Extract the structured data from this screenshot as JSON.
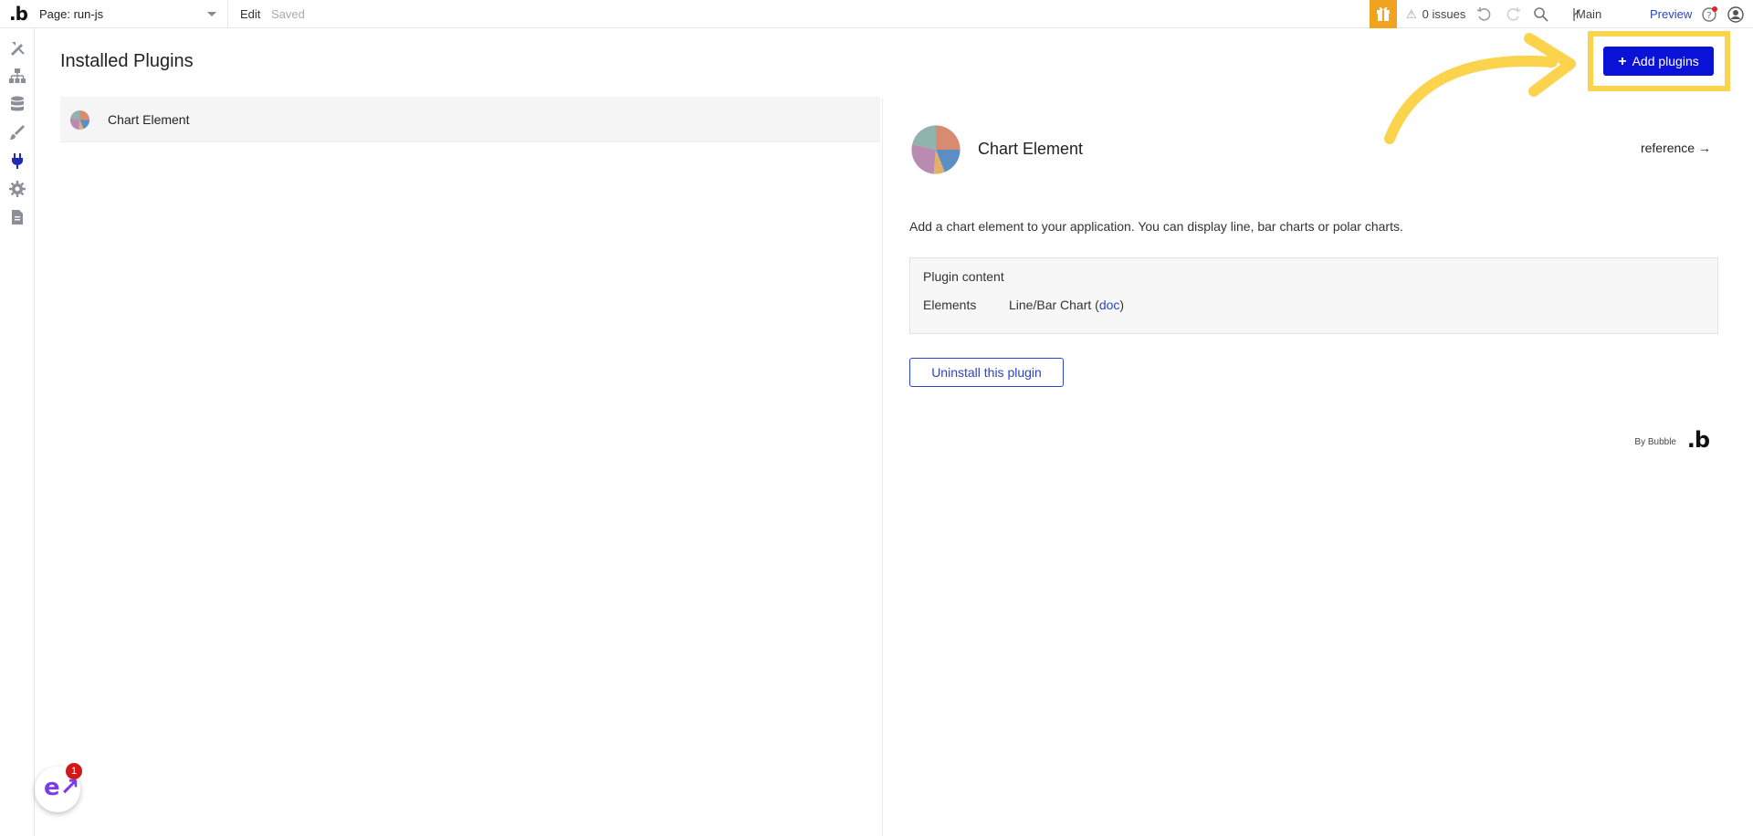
{
  "app": {
    "logo": ".b"
  },
  "topbar": {
    "page_label": "Page: run-js",
    "edit_label": "Edit",
    "saved_label": "Saved",
    "issues_label": "0 issues",
    "branch_label": "Main",
    "preview_label": "Preview"
  },
  "sidebar": {
    "items": [
      {
        "icon": "design-icon"
      },
      {
        "icon": "workflow-icon"
      },
      {
        "icon": "data-icon"
      },
      {
        "icon": "styles-icon"
      },
      {
        "icon": "plugins-icon",
        "active": true
      },
      {
        "icon": "settings-icon"
      },
      {
        "icon": "logs-icon"
      }
    ]
  },
  "main": {
    "title": "Installed Plugins",
    "add_button_label": "Add plugins",
    "plugins": [
      {
        "name": "Chart Element"
      }
    ]
  },
  "detail": {
    "title": "Chart Element",
    "reference_label": "reference →",
    "description": "Add a chart element to your application. You can display line, bar charts or polar charts.",
    "content_heading": "Plugin content",
    "elements_key": "Elements",
    "elements_value": "Line/Bar Chart (",
    "doc_link": "doc",
    "elements_close": ")",
    "uninstall_label": "Uninstall this plugin",
    "by_label": "By Bubble",
    "by_logo": ".b"
  },
  "extension": {
    "badge_count": "1"
  },
  "colors": {
    "accent": "#2b44c8",
    "primary_button": "#0b12d8",
    "highlight": "#fcd34d",
    "gift": "#f0a31e"
  }
}
